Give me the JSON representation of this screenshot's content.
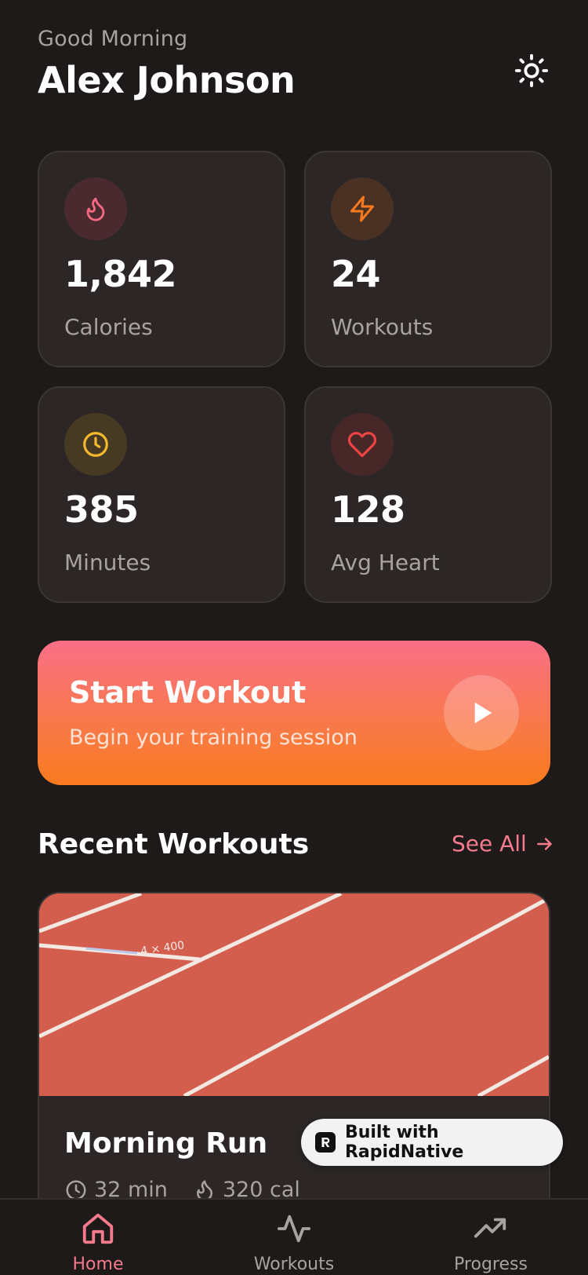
{
  "header": {
    "greeting": "Good Morning",
    "username": "Alex Johnson",
    "theme_icon": "sun-icon"
  },
  "stats": [
    {
      "value": "1,842",
      "label": "Calories",
      "icon": "flame-icon",
      "color": "#f56a82"
    },
    {
      "value": "24",
      "label": "Workouts",
      "icon": "lightning-icon",
      "color": "#f97a1e"
    },
    {
      "value": "385",
      "label": "Minutes",
      "icon": "clock-icon",
      "color": "#f5b82e"
    },
    {
      "value": "128",
      "label": "Avg Heart",
      "icon": "heart-icon",
      "color": "#ef4444"
    }
  ],
  "cta": {
    "title": "Start Workout",
    "subtitle": "Begin your training session",
    "icon": "play-icon"
  },
  "recent": {
    "title": "Recent Workouts",
    "see_all": "See All",
    "workouts": [
      {
        "title": "Morning Run",
        "duration": "32 min",
        "calories": "320 cal"
      }
    ]
  },
  "badge": {
    "label": "Built with RapidNative"
  },
  "tabs": [
    {
      "label": "Home",
      "icon": "home-icon",
      "active": true
    },
    {
      "label": "Workouts",
      "icon": "activity-icon",
      "active": false
    },
    {
      "label": "Progress",
      "icon": "trending-up-icon",
      "active": false
    }
  ],
  "colors": {
    "background": "#1e1a19",
    "card": "#2c2726",
    "accent": "#f57a8c",
    "orange": "#f97a1e"
  }
}
